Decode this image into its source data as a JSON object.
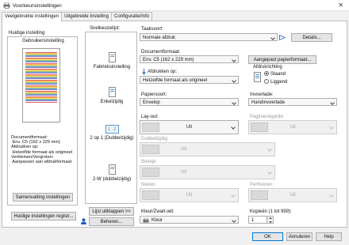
{
  "window": {
    "title": "Voorkeursinstellingen",
    "close_glyph": "✕"
  },
  "tabs": [
    {
      "label": "Veelgebruikte instellingen",
      "active": true
    },
    {
      "label": "Uitgebreide Instelling",
      "active": false
    },
    {
      "label": "Configuratie/Info",
      "active": false
    }
  ],
  "current_setting": {
    "heading": "Huidige instelling",
    "name": "Gebruikersinstelling",
    "info_lines": [
      "Documentformaat:",
      " Env. C5 (162 x 229 mm)",
      "Afdrukken op:",
      " Hetzelfde formaat als origineel",
      "Verkleinen/Vergroten:",
      " Aanpassen aan afdrukformaat"
    ],
    "summary_button": "Samenvatting instellingen",
    "register_button": "Huidige instellingen registr..."
  },
  "quick_select": {
    "heading": "Snelkeuzelijst:",
    "items": [
      {
        "label": "Fabrieksinstelling",
        "icon": "document-icon"
      },
      {
        "label": "Enkelzijdig",
        "icon": "document-icon"
      },
      {
        "label": "2 op 1 (Dubbelzijdig)",
        "icon": "two-up-icon",
        "icon_text": "1→2"
      },
      {
        "label": "2-W (dubbelzijdig)",
        "icon": "document-icon"
      }
    ],
    "unfold_button": "Lijst uitklappen >>",
    "manage_button": "Beheren..."
  },
  "settings": {
    "job_type_label": "Taaksoort:",
    "job_type_value": "Normale afdruk",
    "details_button": "Details...",
    "doc_size_label": "Documentformaat:",
    "doc_size_value": "Env. C5 (162 x 229 mm)",
    "custom_paper_button": "Aangepast papierformaat...",
    "print_on_label": "Afdrukken op:",
    "print_on_value": "Hetzelfde formaat als origineel",
    "orientation_label": "Afdrukrichting",
    "orientation_options": [
      "Staand",
      "Liggend"
    ],
    "orientation_selected": "Staand",
    "paper_type_label": "Papiersoort:",
    "paper_type_value": "Envelop",
    "input_tray_label": "Invoerlade:",
    "input_tray_value": "Handinvoerlade",
    "layout_label": "Lay-out:",
    "layout_value": "Uit",
    "page_order_label": "Paginavolgorde:",
    "page_order_value": "Uit",
    "duplex_label": "Dubbelzijdig:",
    "duplex_value": "Uit",
    "booklet_label": "Boekje:",
    "booklet_value": "Uit",
    "staple_label": "Nieten:",
    "staple_value": "Uit",
    "punch_label": "Perforeren:",
    "punch_value": "Uit",
    "color_label": "Kleur/Zwart-wit:",
    "color_value": "Kleur",
    "copies_label": "Kopieën (1 tot 999):",
    "copies_value": "1"
  },
  "footer": {
    "ok": "OK",
    "cancel": "Annuleren",
    "help": "Help"
  },
  "colors": {
    "accent": "#0078d7",
    "window_bg": "#f0f0f0"
  }
}
